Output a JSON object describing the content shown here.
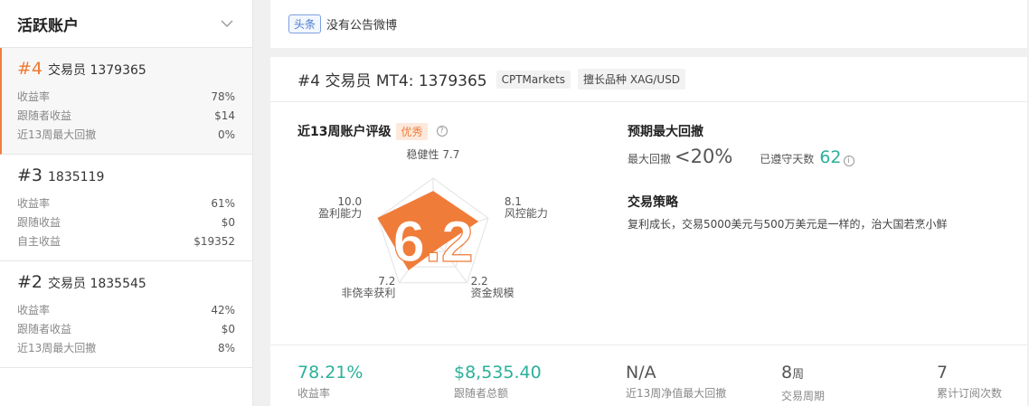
{
  "sidebar": {
    "title": "活跃账户",
    "accounts": [
      {
        "rank": "#4",
        "name": "交易员 1379365",
        "rows": [
          {
            "label": "收益率",
            "value": "78%"
          },
          {
            "label": "跟随者收益",
            "value": "$14"
          },
          {
            "label": "近13周最大回撤",
            "value": "0%"
          }
        ]
      },
      {
        "rank": "#3",
        "name": "1835119",
        "rows": [
          {
            "label": "收益率",
            "value": "61%"
          },
          {
            "label": "跟随收益",
            "value": "$0"
          },
          {
            "label": "自主收益",
            "value": "$19352"
          }
        ]
      },
      {
        "rank": "#2",
        "name": "交易员 1835545",
        "rows": [
          {
            "label": "收益率",
            "value": "42%"
          },
          {
            "label": "跟随者收益",
            "value": "$0"
          },
          {
            "label": "近13周最大回撤",
            "value": "8%"
          }
        ]
      }
    ]
  },
  "notice": {
    "tag": "头条",
    "text": "没有公告微博"
  },
  "panel": {
    "title": "#4 交易员 MT4: 1379365",
    "broker": "CPTMarkets",
    "specialty": "擅长品种 XAG/USD",
    "rating": {
      "title": "近13周账户评级",
      "badge": "优秀",
      "info": "?",
      "score": "6.2",
      "axes": [
        {
          "name": "稳健性",
          "value": "7.7",
          "score": 7.7
        },
        {
          "name": "风控能力",
          "value": "8.1",
          "score": 8.1
        },
        {
          "name": "资金规模",
          "value": "2.2",
          "score": 2.2
        },
        {
          "name": "非侥幸获利",
          "value": "7.2",
          "score": 7.2
        },
        {
          "name": "盈利能力",
          "value": "10.0",
          "score": 10.0
        }
      ]
    },
    "drawdown": {
      "title": "预期最大回撤",
      "label": "最大回撤",
      "value": "<20%",
      "days_label": "已遵守天数",
      "days_value": "62",
      "info": "i"
    },
    "strategy": {
      "title": "交易策略",
      "text": "复利成长，交易5000美元与500万美元是一样的，治大国若烹小鲜"
    },
    "stats": [
      {
        "value": "78.21%",
        "unit": "",
        "label": "收益率"
      },
      {
        "value": "$8,535.40",
        "unit": "",
        "label": "跟随者总额"
      },
      {
        "value": "N/A",
        "unit": "",
        "label": "近13周净值最大回撤"
      },
      {
        "value": "8",
        "unit": "周",
        "label": "交易周期"
      },
      {
        "value": "7",
        "unit": "",
        "label": "累计订阅次数"
      }
    ]
  },
  "colors": {
    "accent": "#f07c3a",
    "green": "#2ab09a",
    "blue": "#4a7bd0"
  }
}
